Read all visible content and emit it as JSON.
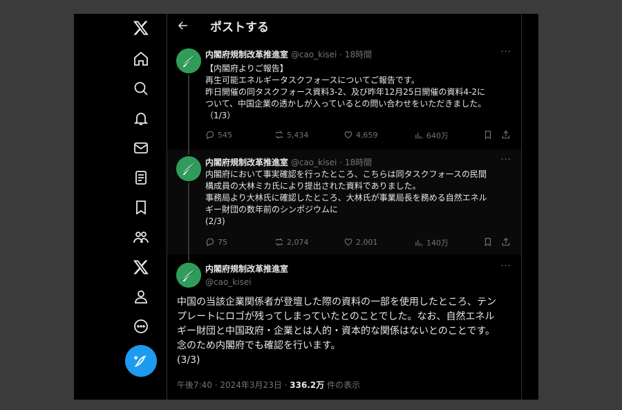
{
  "header": {
    "title": "ポストする"
  },
  "sidebar": {
    "items": [
      {
        "name": "x-logo-icon"
      },
      {
        "name": "home-icon"
      },
      {
        "name": "search-icon"
      },
      {
        "name": "bell-icon"
      },
      {
        "name": "mail-icon"
      },
      {
        "name": "list-icon"
      },
      {
        "name": "bookmark-icon"
      },
      {
        "name": "communities-icon"
      },
      {
        "name": "x-premium-icon"
      },
      {
        "name": "profile-icon"
      },
      {
        "name": "more-icon"
      }
    ],
    "compose": {
      "name": "compose-icon"
    }
  },
  "tweets": [
    {
      "name": "内閣府規制改革推進室",
      "handle": "@cao_kisei",
      "time": "18時間",
      "more": "···",
      "lines": [
        "【内閣府よりご報告】",
        "再生可能エネルギータスクフォースについてご報告です。",
        "昨日開催の同タスクフォース資料3-2、及び昨年12月25日開催の資料4-2に",
        "ついて、中国企業の透かしが入っているとの問い合わせをいただきました。",
        "（1/3）"
      ],
      "replies": "545",
      "retweets": "5,434",
      "likes": "4,659",
      "views": "640万"
    },
    {
      "name": "内閣府規制改革推進室",
      "handle": "@cao_kisei",
      "time": "18時間",
      "more": "···",
      "lines": [
        "内閣府において事実確認を行ったところ、こちらは同タスクフォースの民間",
        "構成員の大林ミカ氏により提出された資料でありました。",
        "事務局より大林氏に確認したところ、大林氏が事業局長を務める自然エネル",
        "ギー財団の数年前のシンポジウムに",
        "(2/3)"
      ],
      "replies": "75",
      "retweets": "2,074",
      "likes": "2,001",
      "views": "140万"
    }
  ],
  "main_tweet": {
    "name": "内閣府規制改革推進室",
    "handle": "@cao_kisei",
    "more": "···",
    "lines": [
      "中国の当該企業関係者が登壇した際の資料の一部を使用したところ、テン",
      "プレートにロゴが残ってしまっていたとのことでした。なお、自然エネル",
      "ギー財団と中国政府・企業とは人的・資本的な関係はないとのことです。",
      "念のため内閣府でも確認を行います。",
      "(3/3)"
    ],
    "timestamp": "午後7:40 · 2024年3月23日 · ",
    "views_count": "336.2万",
    "views_label": " 件の表示"
  },
  "colors": {
    "accent": "#1d9bf0",
    "avatar": "#2f9c5a",
    "muted": "#71767b",
    "text": "#e7e9ea",
    "background": "#000000"
  }
}
